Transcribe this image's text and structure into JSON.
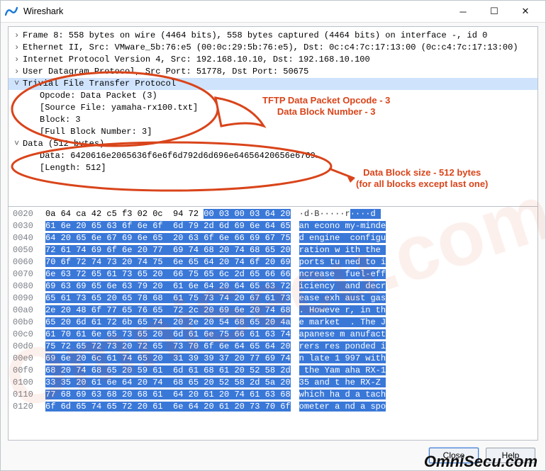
{
  "app": {
    "title": "Wireshark"
  },
  "tree": {
    "frame": "Frame 8: 558 bytes on wire (4464 bits), 558 bytes captured (4464 bits) on interface -, id 0",
    "eth": "Ethernet II, Src: VMware_5b:76:e5 (00:0c:29:5b:76:e5), Dst: 0c:c4:7c:17:13:00 (0c:c4:7c:17:13:00)",
    "ip": "Internet Protocol Version 4, Src: 192.168.10.10, Dst: 192.168.10.100",
    "udp": "User Datagram Protocol, Src Port: 51778, Dst Port: 50675",
    "tftp": "Trivial File Transfer Protocol",
    "opcode": "Opcode: Data Packet (3)",
    "srcfile": "[Source File: yamaha-rx100.txt]",
    "block": "Block: 3",
    "fullblk": "[Full Block Number: 3]",
    "data": "Data (512 bytes)",
    "datahex": "Data: 6420616e2065636f6e6f6d792d6d696e64656420656e6769…",
    "length": "[Length: 512]"
  },
  "annotations": {
    "opcode1": "TFTP Data Packet Opcode - 3",
    "opcode2": "Data Block Number - 3",
    "size1": "Data Block size -  512 bytes",
    "size2": "(for all blocks except last one)"
  },
  "hex": {
    "rows": [
      {
        "o": "0020",
        "pre": "0a 64 ca 42 c5 f3 02 0c  94 72 ",
        "hl": "00 03 00 03 64 20",
        "a_pre": "·d·B·····r",
        "a_hl": "····d "
      },
      {
        "o": "0030",
        "pre": "",
        "hl": "61 6e 20 65 63 6f 6e 6f  6d 79 2d 6d 69 6e 64 65",
        "a_pre": "",
        "a_hl": "an econo my-minde"
      },
      {
        "o": "0040",
        "pre": "",
        "hl": "64 20 65 6e 67 69 6e 65  20 63 6f 6e 66 69 67 75",
        "a_pre": "",
        "a_hl": "d engine  configu"
      },
      {
        "o": "0050",
        "pre": "",
        "hl": "72 61 74 69 6f 6e 20 77  69 74 68 20 74 68 65 20",
        "a_pre": "",
        "a_hl": "ration w ith the "
      },
      {
        "o": "0060",
        "pre": "",
        "hl": "70 6f 72 74 73 20 74 75  6e 65 64 20 74 6f 20 69",
        "a_pre": "",
        "a_hl": "ports tu ned to i"
      },
      {
        "o": "0070",
        "pre": "",
        "hl": "6e 63 72 65 61 73 65 20  66 75 65 6c 2d 65 66 66",
        "a_pre": "",
        "a_hl": "ncrease  fuel-eff"
      },
      {
        "o": "0080",
        "pre": "",
        "hl": "69 63 69 65 6e 63 79 20  61 6e 64 20 64 65 63 72",
        "a_pre": "",
        "a_hl": "iciency  and decr"
      },
      {
        "o": "0090",
        "pre": "",
        "hl": "65 61 73 65 20 65 78 68  61 75 73 74 20 67 61 73",
        "a_pre": "",
        "a_hl": "ease exh aust gas"
      },
      {
        "o": "00a0",
        "pre": "",
        "hl": "2e 20 48 6f 77 65 76 65  72 2c 20 69 6e 20 74 68",
        "a_pre": "",
        "a_hl": ". Howeve r, in th"
      },
      {
        "o": "00b0",
        "pre": "",
        "hl": "65 20 6d 61 72 6b 65 74  20 2e 20 54 68 65 20 4a",
        "a_pre": "",
        "a_hl": "e market  . The J"
      },
      {
        "o": "00c0",
        "pre": "",
        "hl": "61 70 61 6e 65 73 65 20  6d 61 6e 75 66 61 63 74",
        "a_pre": "",
        "a_hl": "apanese m anufact"
      },
      {
        "o": "00d0",
        "pre": "",
        "hl": "75 72 65 72 73 20 72 65  73 70 6f 6e 64 65 64 20",
        "a_pre": "",
        "a_hl": "rers res ponded i"
      },
      {
        "o": "00e0",
        "pre": "",
        "hl": "69 6e 20 6c 61 74 65 20  31 39 39 37 20 77 69 74",
        "a_pre": "",
        "a_hl": "n late 1 997 with"
      },
      {
        "o": "00f0",
        "pre": "",
        "hl": "68 20 74 68 65 20 59 61  6d 61 68 61 20 52 58 2d",
        "a_pre": "",
        "a_hl": " the Yam aha RX-1"
      },
      {
        "o": "0100",
        "pre": "",
        "hl": "33 35 20 61 6e 64 20 74  68 65 20 52 58 2d 5a 20",
        "a_pre": "",
        "a_hl": "35 and t he RX-Z "
      },
      {
        "o": "0110",
        "pre": "",
        "hl": "77 68 69 63 68 20 68 61  64 20 61 20 74 61 63 68",
        "a_pre": "",
        "a_hl": "which ha d a tach"
      },
      {
        "o": "0120",
        "pre": "",
        "hl": "6f 6d 65 74 65 72 20 61  6e 64 20 61 20 73 70 6f",
        "a_pre": "",
        "a_hl": "ometer a nd a spo"
      }
    ]
  },
  "buttons": {
    "close": "Close",
    "help": "Help"
  },
  "brand": "OmniSecu.com",
  "watermark": "OmniSecu.com"
}
